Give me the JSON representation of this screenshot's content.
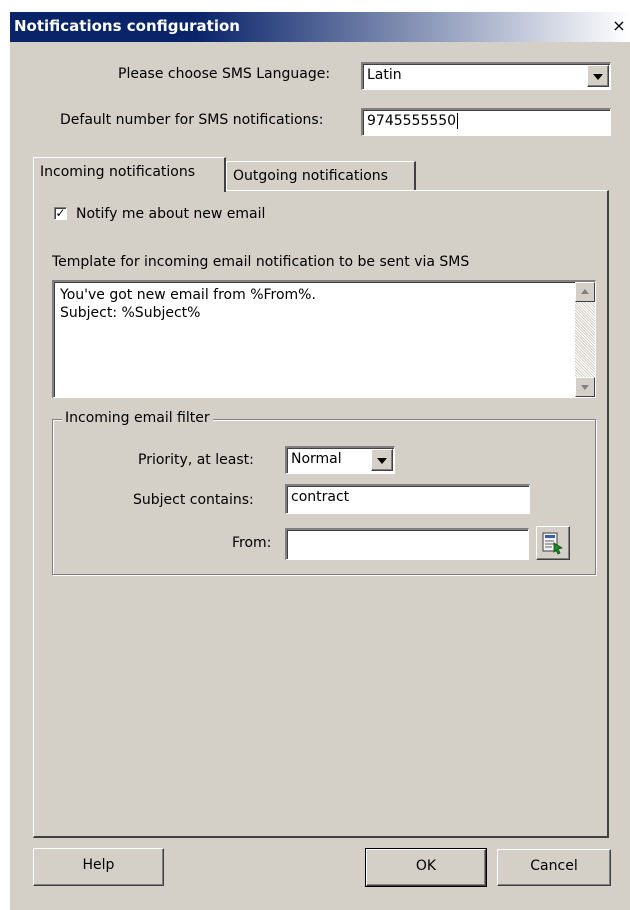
{
  "window": {
    "title": "Notifications configuration",
    "close_glyph": "×"
  },
  "sms": {
    "language_label": "Please choose SMS Language:",
    "language_value": "Latin",
    "number_label": "Default number for SMS notifications:",
    "number_value": "9745555550"
  },
  "tabs": [
    {
      "label": "Incoming notifications",
      "active": true
    },
    {
      "label": "Outgoing notifications",
      "active": false
    }
  ],
  "incoming": {
    "notify_label": "Notify me about new email",
    "notify_checked": true,
    "check_glyph": "✓",
    "template_label": "Template for incoming email notification to be sent via SMS",
    "template_text": "You've got new email from %From%.\nSubject: %Subject%",
    "filter": {
      "legend": "Incoming email filter",
      "priority_label": "Priority, at least:",
      "priority_value": "Normal",
      "subject_label": "Subject contains:",
      "subject_value": "contract",
      "from_label": "From:",
      "from_value": "",
      "address_book_icon": "address-book-icon"
    }
  },
  "buttons": {
    "help": "Help",
    "ok": "OK",
    "cancel": "Cancel"
  },
  "colors": {
    "titlebar": "#0a246a",
    "face": "#d4d0c8"
  }
}
